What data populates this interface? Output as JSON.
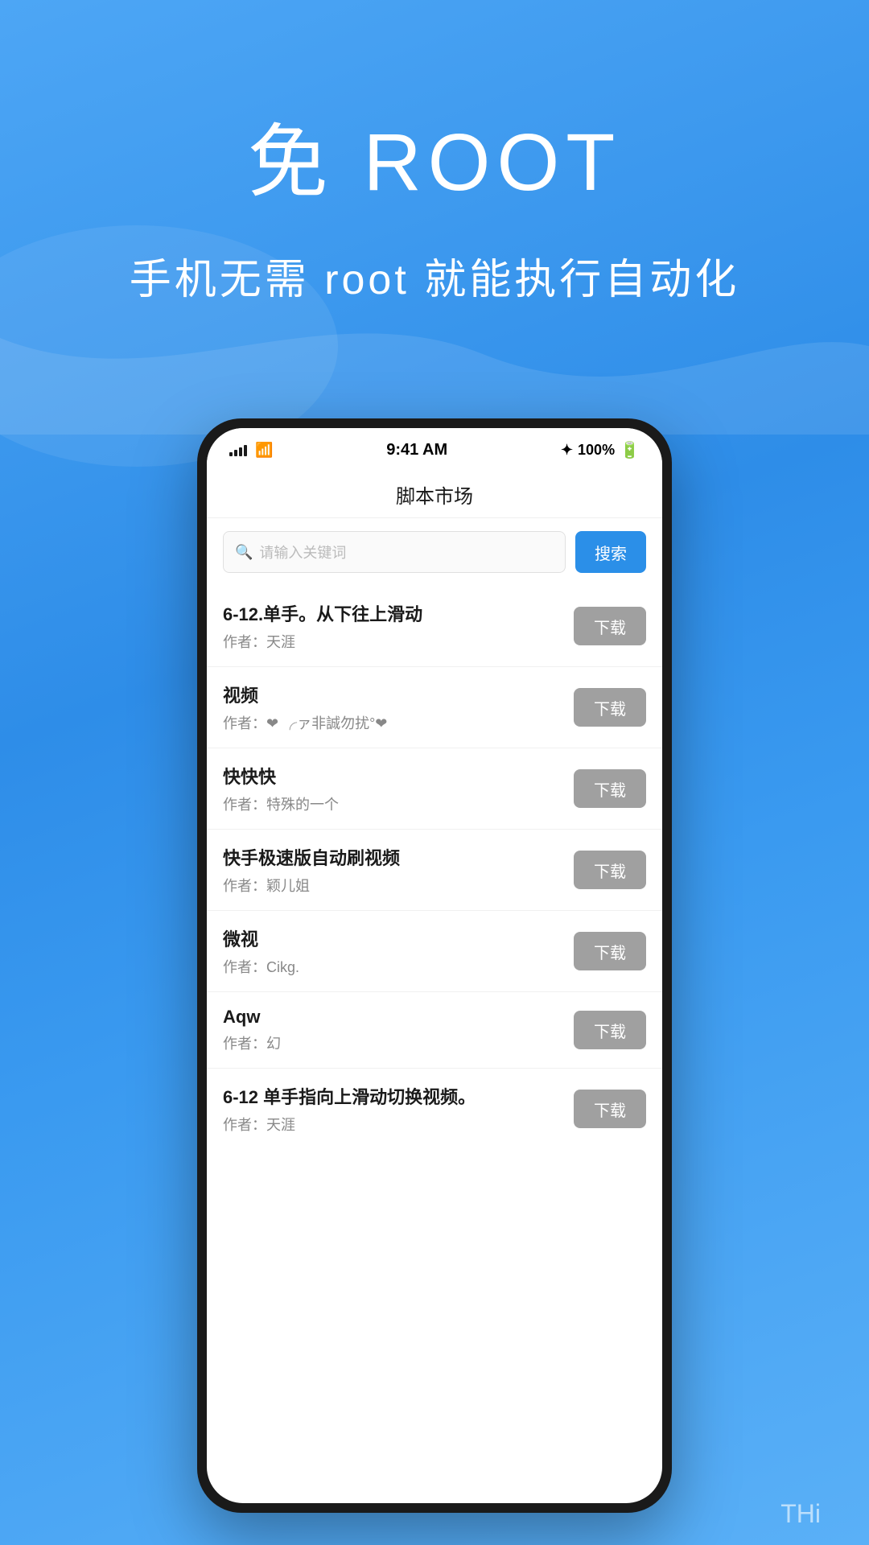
{
  "hero": {
    "title": "免 ROOT",
    "subtitle": "手机无需 root 就能执行自动化"
  },
  "status_bar": {
    "time": "9:41 AM",
    "battery": "100%",
    "bluetooth": "✦"
  },
  "app": {
    "title": "脚本市场"
  },
  "search": {
    "placeholder": "请输入关键词",
    "button_label": "搜索"
  },
  "scripts": [
    {
      "name": "6-12.单手。从下往上滑动",
      "author": "作者：天涯",
      "download_label": "下载"
    },
    {
      "name": "视频",
      "author": "作者：❤ ╭ァ非誠勿扰°❤",
      "download_label": "下载"
    },
    {
      "name": "快快快",
      "author": "作者：特殊的一个",
      "download_label": "下载"
    },
    {
      "name": "快手极速版自动刷视频",
      "author": "作者：颖儿姐",
      "download_label": "下载"
    },
    {
      "name": "微视",
      "author": "作者：Cikg.",
      "download_label": "下载"
    },
    {
      "name": "Aqw",
      "author": "作者：幻",
      "download_label": "下载"
    },
    {
      "name": "6-12 单手指向上滑动切换视频。",
      "author": "作者：天涯",
      "download_label": "下载"
    }
  ],
  "watermark": "THi"
}
